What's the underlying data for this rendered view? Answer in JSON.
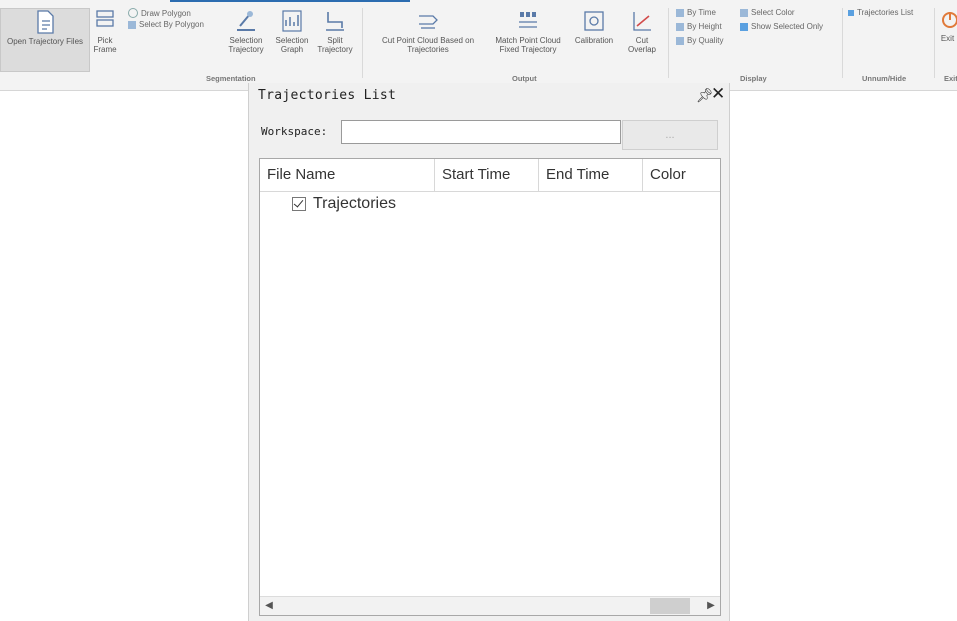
{
  "ribbon": {
    "buttons": [
      {
        "label": "Open Trajectory Files",
        "icon": "document-icon"
      },
      {
        "label": "Pick Frame",
        "icon": "frames-icon"
      },
      {
        "label": "Selection Trajectory",
        "icon": "cursor-select-icon"
      },
      {
        "label": "Selection Graph",
        "icon": "graph-icon"
      },
      {
        "label": "Split Trajectory",
        "icon": "split-icon"
      },
      {
        "label": "Cut Point Cloud Based on Trajectories",
        "icon": "cut-cloud-icon"
      },
      {
        "label": "Match Point Cloud Fixed Trajectory",
        "icon": "match-icon"
      },
      {
        "label": "Calibration",
        "icon": "calibration-icon"
      },
      {
        "label": "Cut Overlap",
        "icon": "cut-overlap-icon"
      }
    ],
    "small_items": [
      {
        "label": "Draw Polygon",
        "icon": "polygon-icon"
      },
      {
        "label": "Select By Polygon",
        "icon": "polygon-select-icon"
      },
      {
        "label": "By Time",
        "icon": "time-icon"
      },
      {
        "label": "By Height",
        "icon": "height-icon"
      },
      {
        "label": "By Quality",
        "icon": "quality-icon"
      },
      {
        "label": "Select Color",
        "icon": "color-icon"
      },
      {
        "label": "Show Selected Only",
        "icon": "filter-icon"
      },
      {
        "label": "Trajectories List",
        "icon": "list-icon"
      }
    ],
    "groups": [
      "Segmentation",
      "Output",
      "Display",
      "Unnum/Hide",
      "Exit"
    ],
    "exit_label": "Exit",
    "accent_color": "#2b6cb0"
  },
  "panel": {
    "title": "Trajectories List",
    "pin_icon": "pin-icon",
    "close_icon": "close-icon",
    "workspace_label": "Workspace:",
    "workspace_value": "",
    "browse_label": "...",
    "columns": [
      "File Name",
      "Start Time",
      "End Time",
      "Color"
    ],
    "items": [
      {
        "label": "Trajectories",
        "checked": true
      }
    ]
  }
}
